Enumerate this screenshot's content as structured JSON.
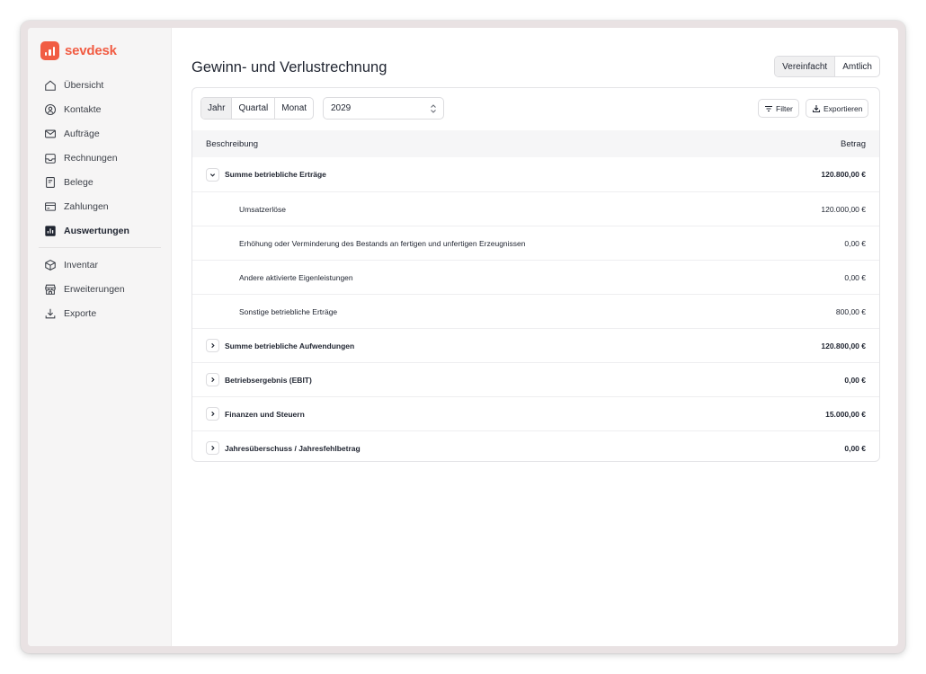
{
  "app": {
    "name": "sevdesk",
    "brand_color": "#f15c43"
  },
  "sidebar": {
    "items": [
      {
        "label": "Übersicht",
        "icon": "home-icon"
      },
      {
        "label": "Kontakte",
        "icon": "contacts-icon"
      },
      {
        "label": "Aufträge",
        "icon": "mail-icon"
      },
      {
        "label": "Rechnungen",
        "icon": "inbox-icon"
      },
      {
        "label": "Belege",
        "icon": "receipt-icon"
      },
      {
        "label": "Zahlungen",
        "icon": "card-icon"
      },
      {
        "label": "Auswertungen",
        "icon": "chart-icon",
        "active": true
      }
    ],
    "items2": [
      {
        "label": "Inventar",
        "icon": "box-icon"
      },
      {
        "label": "Erweiterungen",
        "icon": "store-icon"
      },
      {
        "label": "Exporte",
        "icon": "download-icon"
      }
    ]
  },
  "header": {
    "title": "Gewinn- und Verlustrechnung",
    "view_toggle": {
      "simple": "Vereinfacht",
      "official": "Amtlich",
      "selected": "Vereinfacht"
    }
  },
  "toolbar": {
    "period": {
      "year": "Jahr",
      "quarter": "Quartal",
      "month": "Monat",
      "selected": "Jahr"
    },
    "year_value": "2029",
    "filter_label": "Filter",
    "export_label": "Exportieren"
  },
  "table": {
    "col_description": "Beschreibung",
    "col_amount": "Betrag",
    "rows": [
      {
        "type": "group",
        "expanded": true,
        "label": "Summe betriebliche Erträge",
        "amount": "120.800,00 €"
      },
      {
        "type": "sub",
        "label": "Umsatzerlöse",
        "amount": "120.000,00 €"
      },
      {
        "type": "sub",
        "label": "Erhöhung oder Verminderung des Bestands an fertigen und unfertigen Erzeugnissen",
        "amount": "0,00 €"
      },
      {
        "type": "sub",
        "label": "Andere aktivierte Eigenleistungen",
        "amount": "0,00 €"
      },
      {
        "type": "sub",
        "label": "Sonstige betriebliche Erträge",
        "amount": "800,00 €"
      },
      {
        "type": "group",
        "expanded": false,
        "label": "Summe betriebliche Aufwendungen",
        "amount": "120.800,00 €"
      },
      {
        "type": "group",
        "expanded": false,
        "label": "Betriebsergebnis (EBIT)",
        "amount": "0,00 €"
      },
      {
        "type": "group",
        "expanded": false,
        "label": "Finanzen und Steuern",
        "amount": "15.000,00 €"
      },
      {
        "type": "group",
        "expanded": false,
        "label": "Jahresüberschuss / Jahresfehlbetrag",
        "amount": "0,00 €"
      }
    ]
  }
}
